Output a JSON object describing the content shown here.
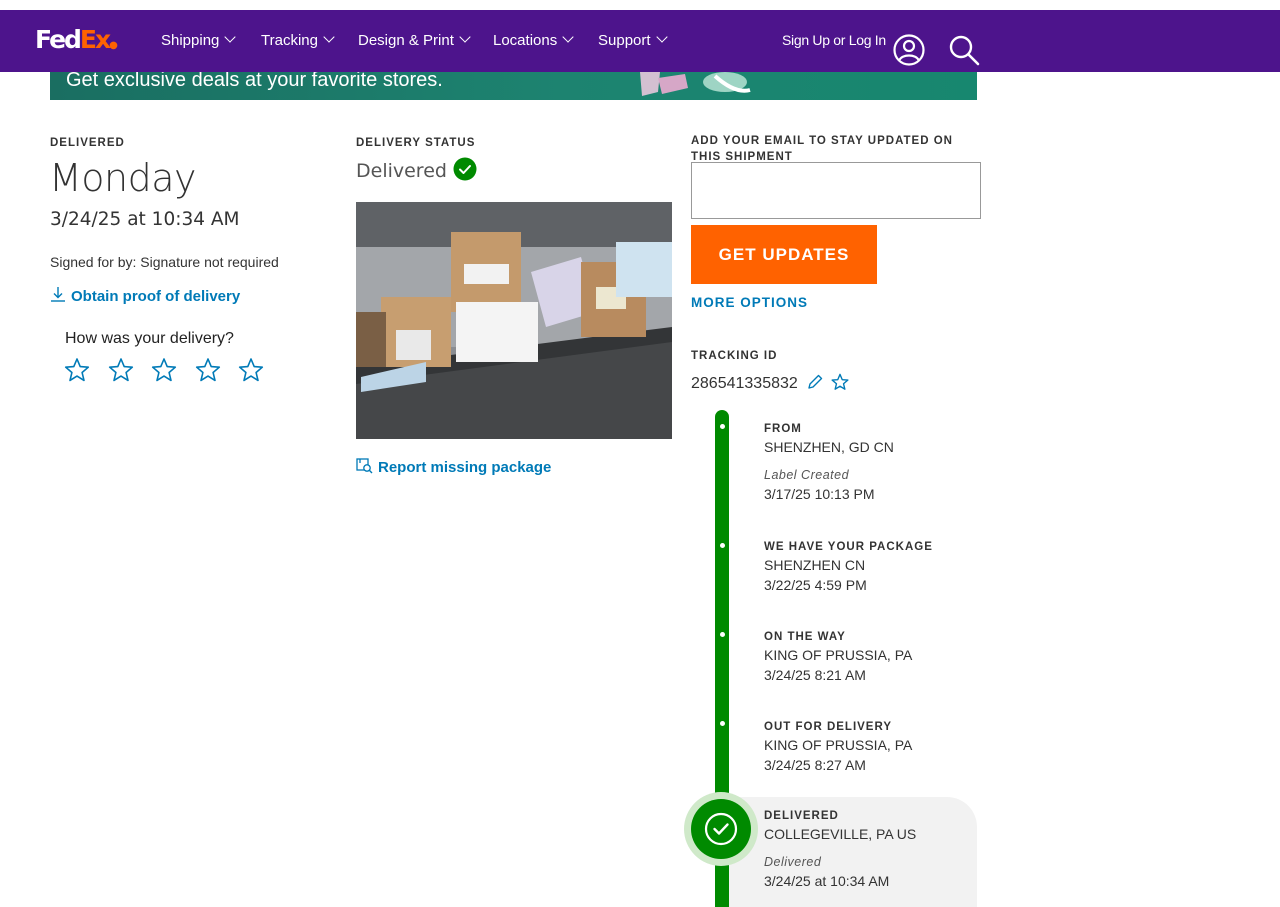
{
  "header": {
    "logo_fed": "Fed",
    "logo_ex": "Ex",
    "nav": [
      "Shipping",
      "Tracking",
      "Design & Print",
      "Locations",
      "Support"
    ],
    "signin": "Sign Up or Log In"
  },
  "banner": {
    "text": "Get exclusive deals at your favorite stores."
  },
  "delivered_col": {
    "label": "DELIVERED",
    "day": "Monday",
    "datetime": "3/24/25 at 10:34 AM",
    "signed": "Signed for by: Signature not required",
    "proof_link": "Obtain proof of delivery",
    "rating_prompt": "How was your delivery?",
    "stars": 5
  },
  "status_col": {
    "label": "DELIVERY STATUS",
    "status": "Delivered",
    "report_link": "Report missing package"
  },
  "updates": {
    "label": "ADD YOUR EMAIL TO STAY UPDATED ON THIS SHIPMENT",
    "email_value": "",
    "button": "GET UPDATES",
    "more": "MORE OPTIONS"
  },
  "tracking": {
    "label": "TRACKING ID",
    "id": "286541335832"
  },
  "timeline": [
    {
      "title": "FROM",
      "location": "SHENZHEN, GD CN",
      "note": "Label Created",
      "time": "3/17/25 10:13 PM"
    },
    {
      "title": "WE HAVE YOUR PACKAGE",
      "location": "SHENZHEN CN",
      "time": "3/22/25 4:59 PM"
    },
    {
      "title": "ON THE WAY",
      "location": "KING OF PRUSSIA, PA",
      "time": "3/24/25 8:21 AM"
    },
    {
      "title": "OUT FOR DELIVERY",
      "location": "KING OF PRUSSIA, PA",
      "time": "3/24/25 8:27 AM"
    },
    {
      "title": "DELIVERED",
      "location": "COLLEGEVILLE, PA US",
      "note": "Delivered",
      "time": "3/24/25 at 10:34 AM"
    }
  ],
  "colors": {
    "brand_purple": "#4d148c",
    "brand_orange": "#ff6200",
    "success_green": "#008a00",
    "link_blue": "#007ab7"
  }
}
